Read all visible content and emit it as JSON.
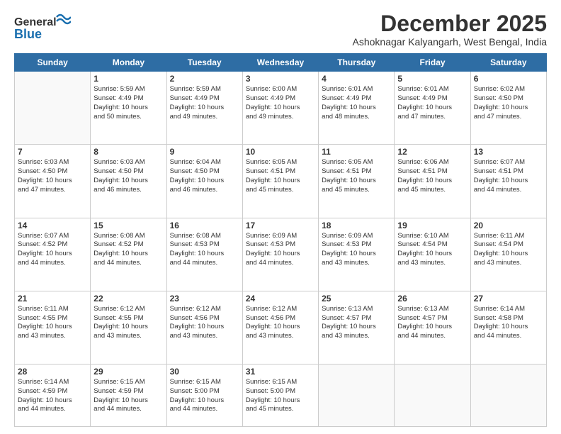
{
  "logo": {
    "line1": "General",
    "line2": "Blue"
  },
  "title": "December 2025",
  "location": "Ashoknagar Kalyangarh, West Bengal, India",
  "weekdays": [
    "Sunday",
    "Monday",
    "Tuesday",
    "Wednesday",
    "Thursday",
    "Friday",
    "Saturday"
  ],
  "weeks": [
    [
      {
        "day": "",
        "info": ""
      },
      {
        "day": "1",
        "info": "Sunrise: 5:59 AM\nSunset: 4:49 PM\nDaylight: 10 hours\nand 50 minutes."
      },
      {
        "day": "2",
        "info": "Sunrise: 5:59 AM\nSunset: 4:49 PM\nDaylight: 10 hours\nand 49 minutes."
      },
      {
        "day": "3",
        "info": "Sunrise: 6:00 AM\nSunset: 4:49 PM\nDaylight: 10 hours\nand 49 minutes."
      },
      {
        "day": "4",
        "info": "Sunrise: 6:01 AM\nSunset: 4:49 PM\nDaylight: 10 hours\nand 48 minutes."
      },
      {
        "day": "5",
        "info": "Sunrise: 6:01 AM\nSunset: 4:49 PM\nDaylight: 10 hours\nand 47 minutes."
      },
      {
        "day": "6",
        "info": "Sunrise: 6:02 AM\nSunset: 4:50 PM\nDaylight: 10 hours\nand 47 minutes."
      }
    ],
    [
      {
        "day": "7",
        "info": "Sunrise: 6:03 AM\nSunset: 4:50 PM\nDaylight: 10 hours\nand 47 minutes."
      },
      {
        "day": "8",
        "info": "Sunrise: 6:03 AM\nSunset: 4:50 PM\nDaylight: 10 hours\nand 46 minutes."
      },
      {
        "day": "9",
        "info": "Sunrise: 6:04 AM\nSunset: 4:50 PM\nDaylight: 10 hours\nand 46 minutes."
      },
      {
        "day": "10",
        "info": "Sunrise: 6:05 AM\nSunset: 4:51 PM\nDaylight: 10 hours\nand 45 minutes."
      },
      {
        "day": "11",
        "info": "Sunrise: 6:05 AM\nSunset: 4:51 PM\nDaylight: 10 hours\nand 45 minutes."
      },
      {
        "day": "12",
        "info": "Sunrise: 6:06 AM\nSunset: 4:51 PM\nDaylight: 10 hours\nand 45 minutes."
      },
      {
        "day": "13",
        "info": "Sunrise: 6:07 AM\nSunset: 4:51 PM\nDaylight: 10 hours\nand 44 minutes."
      }
    ],
    [
      {
        "day": "14",
        "info": "Sunrise: 6:07 AM\nSunset: 4:52 PM\nDaylight: 10 hours\nand 44 minutes."
      },
      {
        "day": "15",
        "info": "Sunrise: 6:08 AM\nSunset: 4:52 PM\nDaylight: 10 hours\nand 44 minutes."
      },
      {
        "day": "16",
        "info": "Sunrise: 6:08 AM\nSunset: 4:53 PM\nDaylight: 10 hours\nand 44 minutes."
      },
      {
        "day": "17",
        "info": "Sunrise: 6:09 AM\nSunset: 4:53 PM\nDaylight: 10 hours\nand 44 minutes."
      },
      {
        "day": "18",
        "info": "Sunrise: 6:09 AM\nSunset: 4:53 PM\nDaylight: 10 hours\nand 43 minutes."
      },
      {
        "day": "19",
        "info": "Sunrise: 6:10 AM\nSunset: 4:54 PM\nDaylight: 10 hours\nand 43 minutes."
      },
      {
        "day": "20",
        "info": "Sunrise: 6:11 AM\nSunset: 4:54 PM\nDaylight: 10 hours\nand 43 minutes."
      }
    ],
    [
      {
        "day": "21",
        "info": "Sunrise: 6:11 AM\nSunset: 4:55 PM\nDaylight: 10 hours\nand 43 minutes."
      },
      {
        "day": "22",
        "info": "Sunrise: 6:12 AM\nSunset: 4:55 PM\nDaylight: 10 hours\nand 43 minutes."
      },
      {
        "day": "23",
        "info": "Sunrise: 6:12 AM\nSunset: 4:56 PM\nDaylight: 10 hours\nand 43 minutes."
      },
      {
        "day": "24",
        "info": "Sunrise: 6:12 AM\nSunset: 4:56 PM\nDaylight: 10 hours\nand 43 minutes."
      },
      {
        "day": "25",
        "info": "Sunrise: 6:13 AM\nSunset: 4:57 PM\nDaylight: 10 hours\nand 43 minutes."
      },
      {
        "day": "26",
        "info": "Sunrise: 6:13 AM\nSunset: 4:57 PM\nDaylight: 10 hours\nand 44 minutes."
      },
      {
        "day": "27",
        "info": "Sunrise: 6:14 AM\nSunset: 4:58 PM\nDaylight: 10 hours\nand 44 minutes."
      }
    ],
    [
      {
        "day": "28",
        "info": "Sunrise: 6:14 AM\nSunset: 4:59 PM\nDaylight: 10 hours\nand 44 minutes."
      },
      {
        "day": "29",
        "info": "Sunrise: 6:15 AM\nSunset: 4:59 PM\nDaylight: 10 hours\nand 44 minutes."
      },
      {
        "day": "30",
        "info": "Sunrise: 6:15 AM\nSunset: 5:00 PM\nDaylight: 10 hours\nand 44 minutes."
      },
      {
        "day": "31",
        "info": "Sunrise: 6:15 AM\nSunset: 5:00 PM\nDaylight: 10 hours\nand 45 minutes."
      },
      {
        "day": "",
        "info": ""
      },
      {
        "day": "",
        "info": ""
      },
      {
        "day": "",
        "info": ""
      }
    ]
  ]
}
